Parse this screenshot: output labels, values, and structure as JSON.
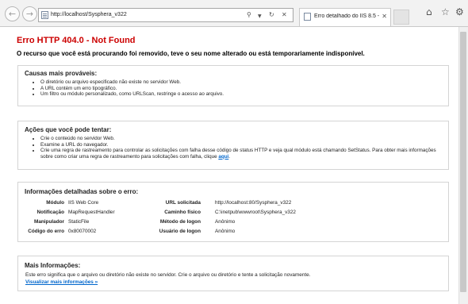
{
  "browser": {
    "url": "http://localhost/Sysphera_v322",
    "tab_title": "Erro detalhado do IIS 8.5 - 4...",
    "icons": [
      "back-icon",
      "forward-icon",
      "page-icon",
      "search-icon",
      "dropdown-icon",
      "refresh-icon",
      "stop-icon",
      "tab-close-icon",
      "home-icon",
      "favorites-icon",
      "settings-icon"
    ]
  },
  "error": {
    "title": "Erro HTTP 404.0 - Not Found",
    "subtitle": "O recurso que você está procurando foi removido, teve o seu nome alterado ou está temporariamente indisponível."
  },
  "causes": {
    "heading": "Causas mais prováveis:",
    "items": [
      "O diretório ou arquivo especificado não existe no servidor Web.",
      "A URL contém um erro tipográfico.",
      "Um filtro ou módulo personalizado, como URLScan, restringe o acesso ao arquivo."
    ]
  },
  "actions": {
    "heading": "Ações que você pode tentar:",
    "items": [
      "Crie o conteúdo no servidor Web.",
      "Examine a URL do navegador."
    ],
    "item3_text": "Crie uma regra de rastreamento para controlar as solicitações com falha desse código de status HTTP e veja qual módulo está chamando SetStatus. Para obter mais informações sobre como criar uma regra de rastreamento para solicitações com falha, clique ",
    "item3_link": "aqui",
    "item3_end": "."
  },
  "details": {
    "heading": "Informações detalhadas sobre o erro:",
    "left": [
      {
        "label": "Módulo",
        "value": "IIS Web Core"
      },
      {
        "label": "Notificação",
        "value": "MapRequestHandler"
      },
      {
        "label": "Manipulador",
        "value": "StaticFile"
      },
      {
        "label": "Código do erro",
        "value": "0x80070002"
      }
    ],
    "right": [
      {
        "label": "URL solicitada",
        "value": "http://localhost:80/Sysphera_v322"
      },
      {
        "label": "Caminho físico",
        "value": "C:\\inetpub\\wwwroot\\Sysphera_v322"
      },
      {
        "label": "Método de logon",
        "value": "Anônimo"
      },
      {
        "label": "Usuário de logon",
        "value": "Anônimo"
      }
    ]
  },
  "more_info": {
    "heading": "Mais Informações:",
    "text": "Este erro significa que o arquivo ou diretório não existe no servidor. Crie o arquivo ou diretório e tente a solicitação novamente.",
    "link": "Visualizar mais informações »"
  }
}
